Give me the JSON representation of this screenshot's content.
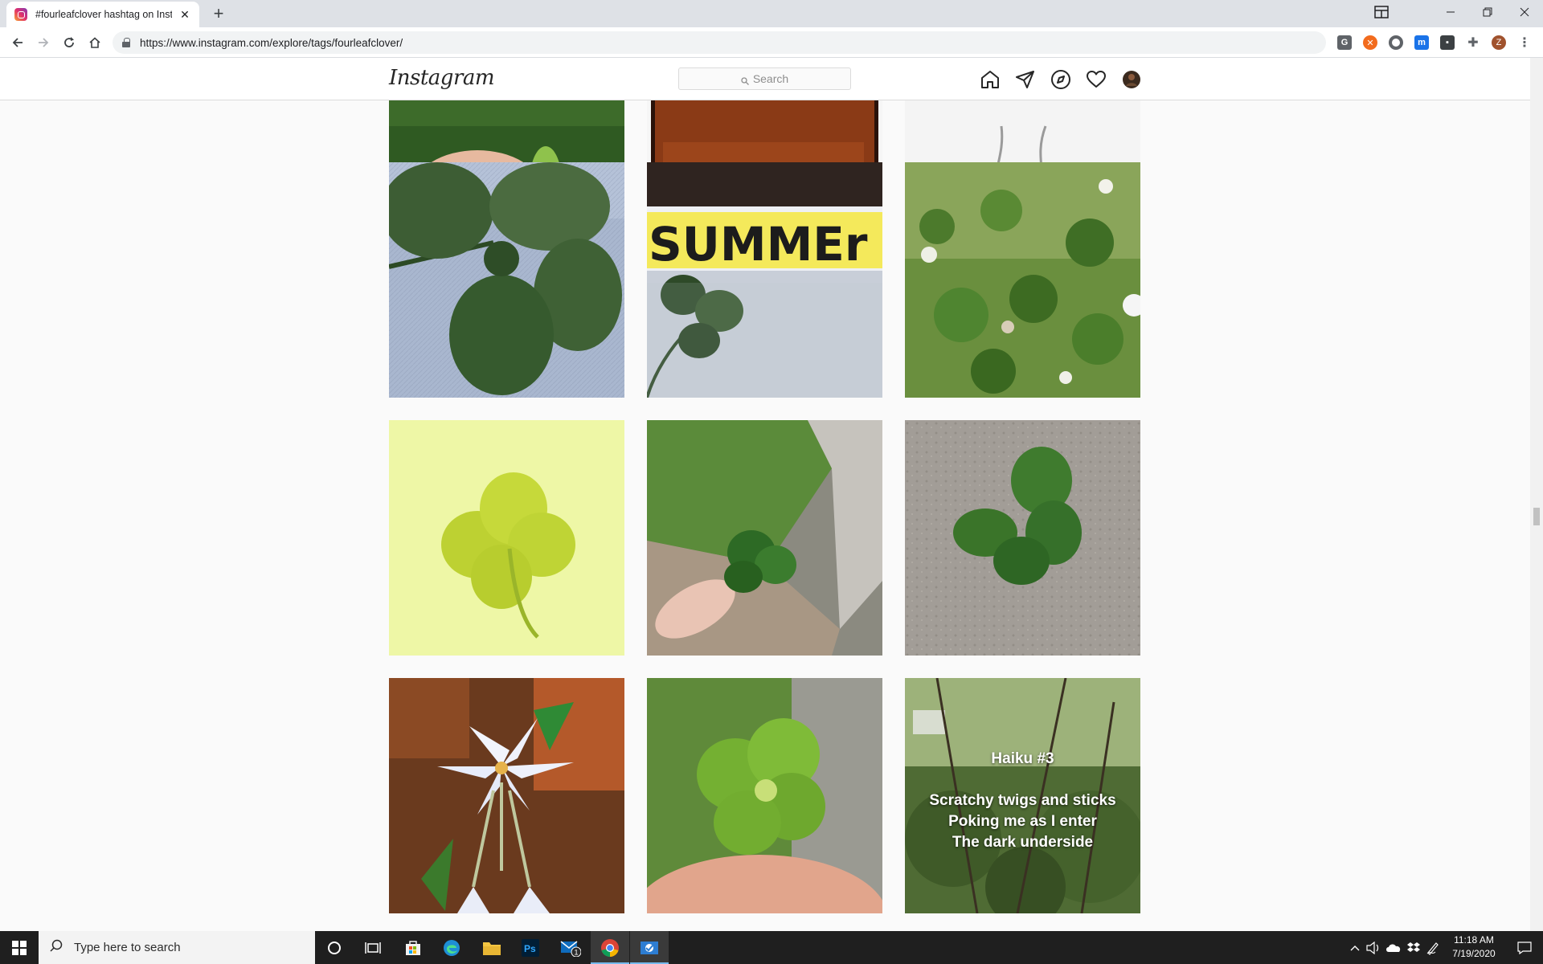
{
  "browser": {
    "tab": {
      "title": "#fourleafclover hashtag on Insta"
    },
    "url": "https://www.instagram.com/explore/tags/fourleafclover/"
  },
  "instagram": {
    "logo": "Instagram",
    "search": {
      "placeholder": "Search"
    },
    "nav_icons": [
      "home-icon",
      "direct-message-icon",
      "explore-icon",
      "activity-heart-icon",
      "profile-avatar"
    ]
  },
  "grid": {
    "posts": [
      {
        "id": "post-row0-col0",
        "alt_icon": "hand-clover-image"
      },
      {
        "id": "post-row0-col1",
        "alt_icon": "wood-tray-image"
      },
      {
        "id": "post-row0-col2",
        "alt_icon": "sketch-image"
      },
      {
        "id": "post-row1-col0",
        "alt_icon": "clover-on-denim-image"
      },
      {
        "id": "post-row1-col1",
        "overlay_text": "SUMMEr"
      },
      {
        "id": "post-row1-col2",
        "alt_icon": "clover-patch-image"
      },
      {
        "id": "post-row2-col0",
        "alt_icon": "yellow-clover-image"
      },
      {
        "id": "post-row2-col1",
        "alt_icon": "clover-held-outdoors-image"
      },
      {
        "id": "post-row2-col2",
        "alt_icon": "clover-on-concrete-image"
      },
      {
        "id": "post-row3-col0",
        "alt_icon": "white-lily-image"
      },
      {
        "id": "post-row3-col1",
        "alt_icon": "clover-held-image"
      },
      {
        "id": "post-row3-col2",
        "haiku": {
          "title": "Haiku #3",
          "line1": "Scratchy twigs and sticks",
          "line2": "Poking me as I enter",
          "line3": "The dark underside"
        }
      }
    ]
  },
  "taskbar": {
    "search_placeholder": "Type here to search",
    "mail_badge": "1",
    "time": "11:18 AM",
    "date": "7/19/2020"
  },
  "colors": {
    "ig_border": "#dbdbdb",
    "chrome_tabbar": "#dee1e6",
    "taskbar_bg": "#1f1f1f"
  }
}
